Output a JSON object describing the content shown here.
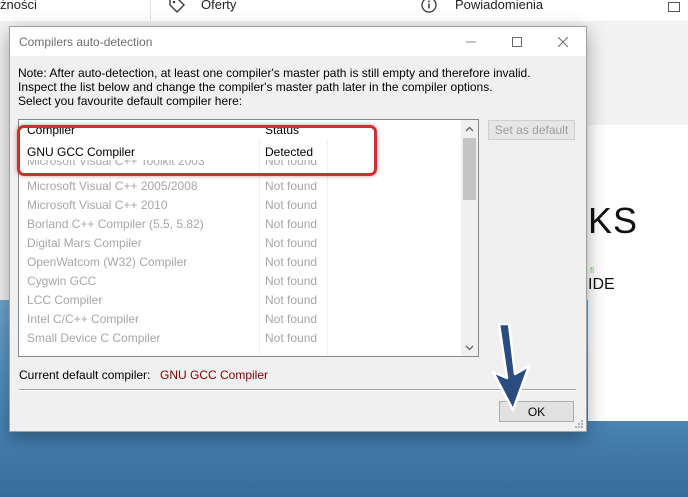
{
  "background": {
    "tab_partial_label": "żności",
    "tab_offers_label": "Oferty",
    "tab_notifications_label": "Powiadomienia",
    "card_big_text": "KS",
    "card_ide_text": "IDE",
    "card_tiny_text": "fi",
    "offers_icon": "tag-icon",
    "notifications_icon": "info-icon"
  },
  "dialog": {
    "title": "Compilers auto-detection",
    "note_lines": [
      "Note: After auto-detection, at least one compiler's master path is still empty and therefore invalid.",
      "Inspect the list below and change the compiler's master path later in the compiler options.",
      "Select you favourite default compiler here:"
    ],
    "columns": {
      "compiler": "Compiler",
      "status": "Status"
    },
    "rows": [
      {
        "name": "GNU GCC Compiler",
        "status": "Detected"
      },
      {
        "name": "Microsoft Visual C++ Toolkit 2003",
        "status": "Not found"
      },
      {
        "name": "Microsoft Visual C++ 2005/2008",
        "status": "Not found"
      },
      {
        "name": "Microsoft Visual C++ 2010",
        "status": "Not found"
      },
      {
        "name": "Borland C++ Compiler (5.5, 5.82)",
        "status": "Not found"
      },
      {
        "name": "Digital Mars Compiler",
        "status": "Not found"
      },
      {
        "name": "OpenWatcom (W32) Compiler",
        "status": "Not found"
      },
      {
        "name": "Cygwin GCC",
        "status": "Not found"
      },
      {
        "name": "LCC Compiler",
        "status": "Not found"
      },
      {
        "name": "Intel C/C++ Compiler",
        "status": "Not found"
      },
      {
        "name": "Small Device C Compiler",
        "status": "Not found"
      }
    ],
    "set_default_label": "Set as default",
    "current_default_label": "Current default compiler:",
    "current_default_value": "GNU GCC Compiler",
    "ok_label": "OK",
    "colors": {
      "highlight": "#d12f2f",
      "current_value": "#800000",
      "arrow": "#2a4c7e"
    }
  }
}
